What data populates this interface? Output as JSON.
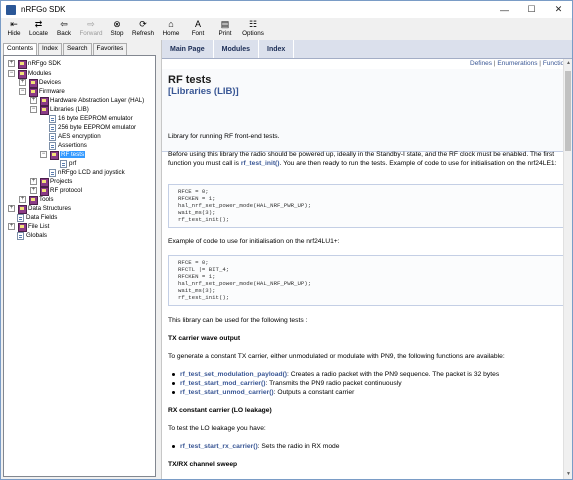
{
  "window": {
    "title": "nRFGo SDK",
    "minimize": "—",
    "maximize": "☐",
    "close": "✕"
  },
  "toolbar": {
    "hide": "Hide",
    "locate": "Locate",
    "back": "Back",
    "forward": "Forward",
    "stop": "Stop",
    "refresh": "Refresh",
    "home": "Home",
    "font": "Font",
    "print": "Print",
    "options": "Options"
  },
  "tabs": {
    "contents": "Contents",
    "index": "Index",
    "search": "Search",
    "favorites": "Favorites"
  },
  "tree": {
    "nrfgo_sdk": "nRFgo SDK",
    "modules": "Modules",
    "devices": "Devices",
    "firmware": "Firmware",
    "hal": "Hardware Abstraction Layer (HAL)",
    "libraries": "Libraries (LIB)",
    "eeprom16": "16 byte EEPROM emulator",
    "eeprom256": "256 byte EEPROM emulator",
    "aes": "AES encryption",
    "assertions": "Assertions",
    "rftests": "RF tests",
    "prf": "prf",
    "lcd": "nRFgo LCD and joystick",
    "projects": "Projects",
    "rfprotocol": "RF protocol",
    "tools": "Tools",
    "datastructures": "Data Structures",
    "datafields": "Data Fields",
    "filelist": "File List",
    "globals": "Globals"
  },
  "nav": {
    "main_page": "Main Page",
    "modules": "Modules",
    "index": "Index"
  },
  "links": {
    "defines": "Defines",
    "sep": "|",
    "enumerations": "Enumerations",
    "functions": "Functions"
  },
  "page": {
    "title": "RF tests",
    "subtitle": "[Libraries (LIB)]",
    "intro": "Library for running RF front-end tests.",
    "before1": "Before using this library the radio should be powered up, ideally in the Standby-I state, and the RF clock must be enabled. The first function you must call is ",
    "before_fn": "rf_test_init()",
    "before2": ". You are then ready to run the tests. Example of code to use for initialisation on the nrf24LE1:",
    "code1": [
      "RFCE = 0;",
      "RFCKEN = 1;",
      "hal_nrf_set_power_mode(HAL_NRF_PWR_UP);",
      "wait_ms(3);",
      "rf_test_init();"
    ],
    "lu1_text": "Example of code to use for initialisation on the nrf24LU1+:",
    "code2": [
      "RFCE = 0;",
      "RFCTL |= BIT_4;",
      "RFCKEN = 1;",
      "hal_nrf_set_power_mode(HAL_NRF_PWR_UP);",
      "wait_ms(3);",
      "rf_test_init();"
    ],
    "usage": "This library can be used for the following tests :",
    "tx_heading": "TX carrier wave output",
    "tx_text": "To generate a constant TX carrier, either unmodulated or modulate with PN9, the following functions are available:",
    "tx_items": [
      {
        "fn": "rf_test_set_modulation_payload()",
        "desc": ": Creates a radio packet with the PN9 sequence. The packet is 32 bytes"
      },
      {
        "fn": "rf_test_start_mod_carrier()",
        "desc": ": Transmits the PN9 radio packet continuously"
      },
      {
        "fn": "rf_test_start_unmod_carrier()",
        "desc": ": Outputs a constant carrier"
      }
    ],
    "rx_heading": "RX constant carrier (LO leakage)",
    "rx_text": "To test the LO leakage you have:",
    "rx_items": [
      {
        "fn": "rf_test_start_rx_carrier()",
        "desc": ": Sets the radio in RX mode"
      }
    ],
    "sweep_heading": "TX/RX channel sweep"
  },
  "colors": {
    "link": "#3a5795",
    "nav_bg": "#dbe0ec",
    "selection": "#3399ff"
  }
}
